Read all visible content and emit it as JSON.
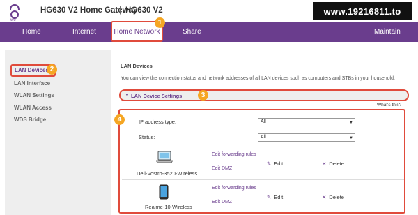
{
  "header": {
    "title": "HG630 V2 Home Gateway",
    "separator": "|",
    "model": "HG630 V2",
    "watermark": "www.19216811.to"
  },
  "nav": {
    "items": [
      "Home",
      "Internet",
      "Home Network",
      "Share",
      "Maintain"
    ]
  },
  "badges": [
    "1",
    "2",
    "3",
    "4"
  ],
  "sidebar": {
    "items": [
      "LAN Devices",
      "LAN Interface",
      "WLAN Settings",
      "WLAN Access",
      "WDS Bridge"
    ]
  },
  "main": {
    "title": "LAN Devices",
    "description": "You can view the connection status and network addresses of all LAN devices such as computers and STBs in your household.",
    "section_label": "LAN Device Settings",
    "whats_this": "What's this?",
    "filters": [
      {
        "label": "IP address type:",
        "value": "All"
      },
      {
        "label": "Status:",
        "value": "All"
      }
    ],
    "devices": [
      {
        "name": "Dell-Vostro-3520-Wireless",
        "icon": "laptop-icon",
        "link1": "Edit forwarding rules",
        "link2": "Edit DMZ",
        "edit": "Edit",
        "delete": "Delete"
      },
      {
        "name": "Realme-10-Wireless",
        "icon": "phone-icon",
        "link1": "Edit forwarding rules",
        "link2": "Edit DMZ",
        "edit": "Edit",
        "delete": "Delete"
      }
    ]
  },
  "colors": {
    "brand": "#6a3d8d",
    "highlight": "#e04b3c",
    "badge": "#f5a623"
  }
}
